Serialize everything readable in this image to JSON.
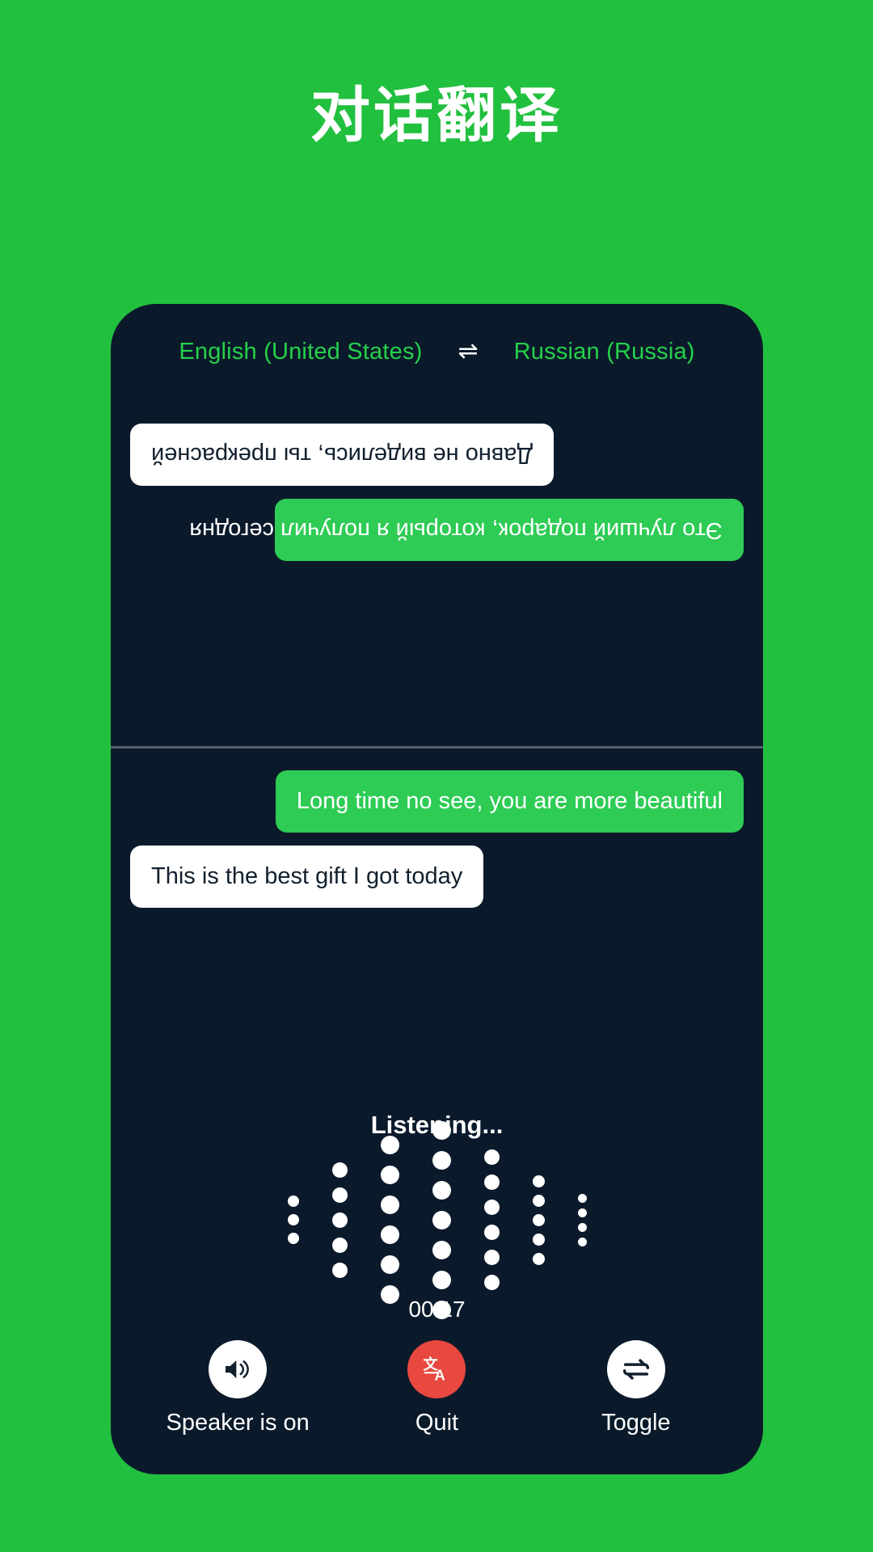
{
  "header": {
    "title": "对话翻译"
  },
  "theme": {
    "background": "#22c03f",
    "screen_background": "#0b1a2b",
    "accent_green": "#2ecc55",
    "lang_text": "#25d14b",
    "quit_red": "#e8483f",
    "bubble_white": "#ffffff"
  },
  "language_bar": {
    "source": "English (United States)",
    "swap_icon": "swap-arrows-icon",
    "swap_glyph": "⇌",
    "target": "Russian (Russia)"
  },
  "conversation": {
    "remote_pane": {
      "orientation": "rotated-180",
      "messages": [
        {
          "text": "Это лучший подарок, который я получил сегодня",
          "style": "green",
          "align": "left"
        },
        {
          "text": "Давно не виделись, ты прекрасней",
          "style": "white",
          "align": "right"
        }
      ]
    },
    "local_pane": {
      "orientation": "normal",
      "messages": [
        {
          "text": "Long time no see, you are more beautiful",
          "style": "green",
          "align": "right"
        },
        {
          "text": "This is the best gift I got today",
          "style": "white",
          "align": "left"
        }
      ]
    }
  },
  "status": {
    "listening_label": "Listening...",
    "timer": "00:17"
  },
  "waveform": {
    "columns": [
      {
        "count": 3,
        "size": 14
      },
      {
        "count": 5,
        "size": 19
      },
      {
        "count": 6,
        "size": 23
      },
      {
        "count": 7,
        "size": 23
      },
      {
        "count": 6,
        "size": 19
      },
      {
        "count": 5,
        "size": 15
      },
      {
        "count": 4,
        "size": 11
      }
    ]
  },
  "controls": [
    {
      "id": "speaker",
      "icon": "speaker-on-icon",
      "label": "Speaker is on",
      "circle_style": "white"
    },
    {
      "id": "quit",
      "icon": "translate-icon",
      "label": "Quit",
      "circle_style": "red"
    },
    {
      "id": "toggle",
      "icon": "toggle-swap-icon",
      "label": "Toggle",
      "circle_style": "white"
    }
  ]
}
